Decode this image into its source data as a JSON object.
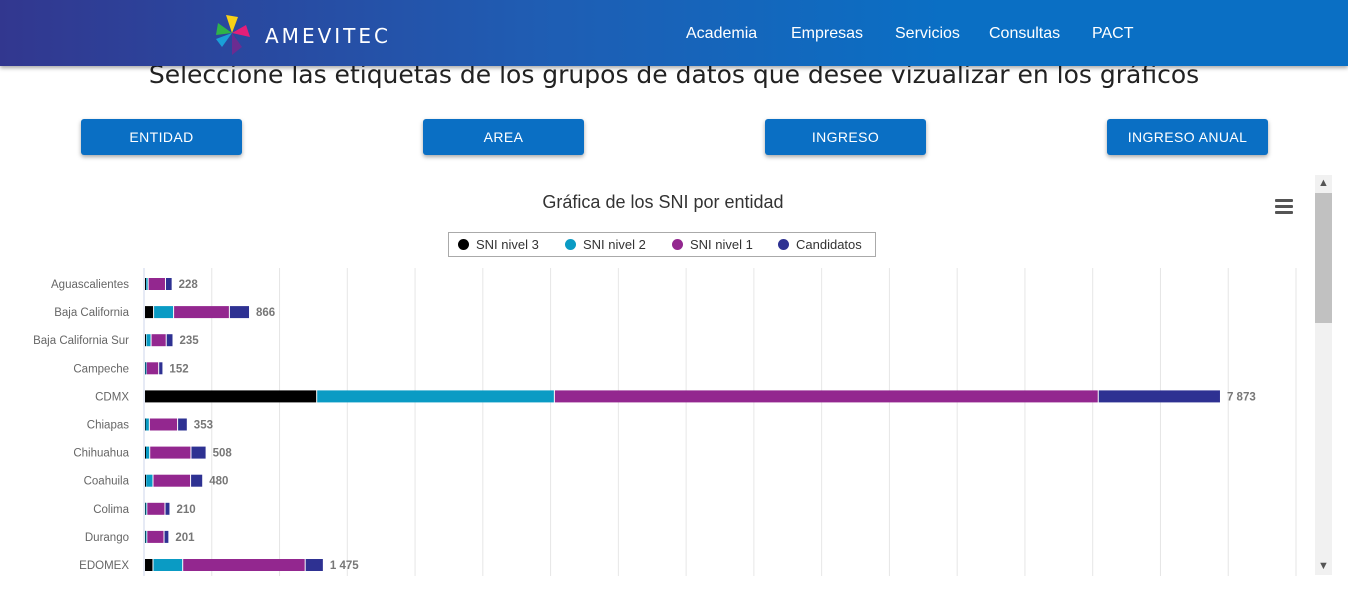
{
  "nav": {
    "brand": "AMEVITEC",
    "items": [
      "Academia",
      "Empresas",
      "Servicios",
      "Consultas",
      "PACT"
    ]
  },
  "headline": "Seleccione las etiquetas de los grupos de datos que desee vizualizar en los gráficos",
  "buttons": [
    "ENTIDAD",
    "AREA",
    "INGRESO",
    "INGRESO ANUAL"
  ],
  "colors": {
    "nav_start": "#32378f",
    "nav_end": "#0a6fc4",
    "button": "#0a6fc4",
    "sni3": "#000000",
    "sni2": "#0a9bc4",
    "sni1": "#93278f",
    "candidatos": "#2e3192"
  },
  "icons": [
    "amevitec-logo",
    "hamburger-menu-icon",
    "chevron-up-icon",
    "chevron-down-icon"
  ],
  "chart_data": {
    "type": "bar",
    "orientation": "horizontal",
    "stacked": true,
    "title": "Gráfica de los SNI por entidad",
    "legend_position": "top-center",
    "grid": true,
    "categories": [
      "Aguascalientes",
      "Baja California",
      "Baja California Sur",
      "Campeche",
      "CDMX",
      "Chiapas",
      "Chihuahua",
      "Coahuila",
      "Colima",
      "Durango",
      "EDOMEX"
    ],
    "series": [
      {
        "name": "SNI nivel 3",
        "values": [
          10,
          75,
          12,
          3,
          1420,
          5,
          8,
          10,
          4,
          4,
          70
        ]
      },
      {
        "name": "SNI nivel 2",
        "values": [
          20,
          165,
          42,
          11,
          1960,
          35,
          35,
          60,
          15,
          15,
          245
        ]
      },
      {
        "name": "SNI nivel 1",
        "values": [
          143,
          460,
          125,
          103,
          4485,
          233,
          340,
          310,
          150,
          142,
          1010
        ]
      },
      {
        "name": "Candidatos",
        "values": [
          55,
          166,
          56,
          35,
          1008,
          80,
          125,
          100,
          41,
          40,
          150
        ]
      }
    ],
    "totals": [
      "228",
      "866",
      "235",
      "152",
      "7 873",
      "353",
      "508",
      "480",
      "210",
      "201",
      "1 475"
    ],
    "xlim": [
      0,
      9500
    ]
  }
}
